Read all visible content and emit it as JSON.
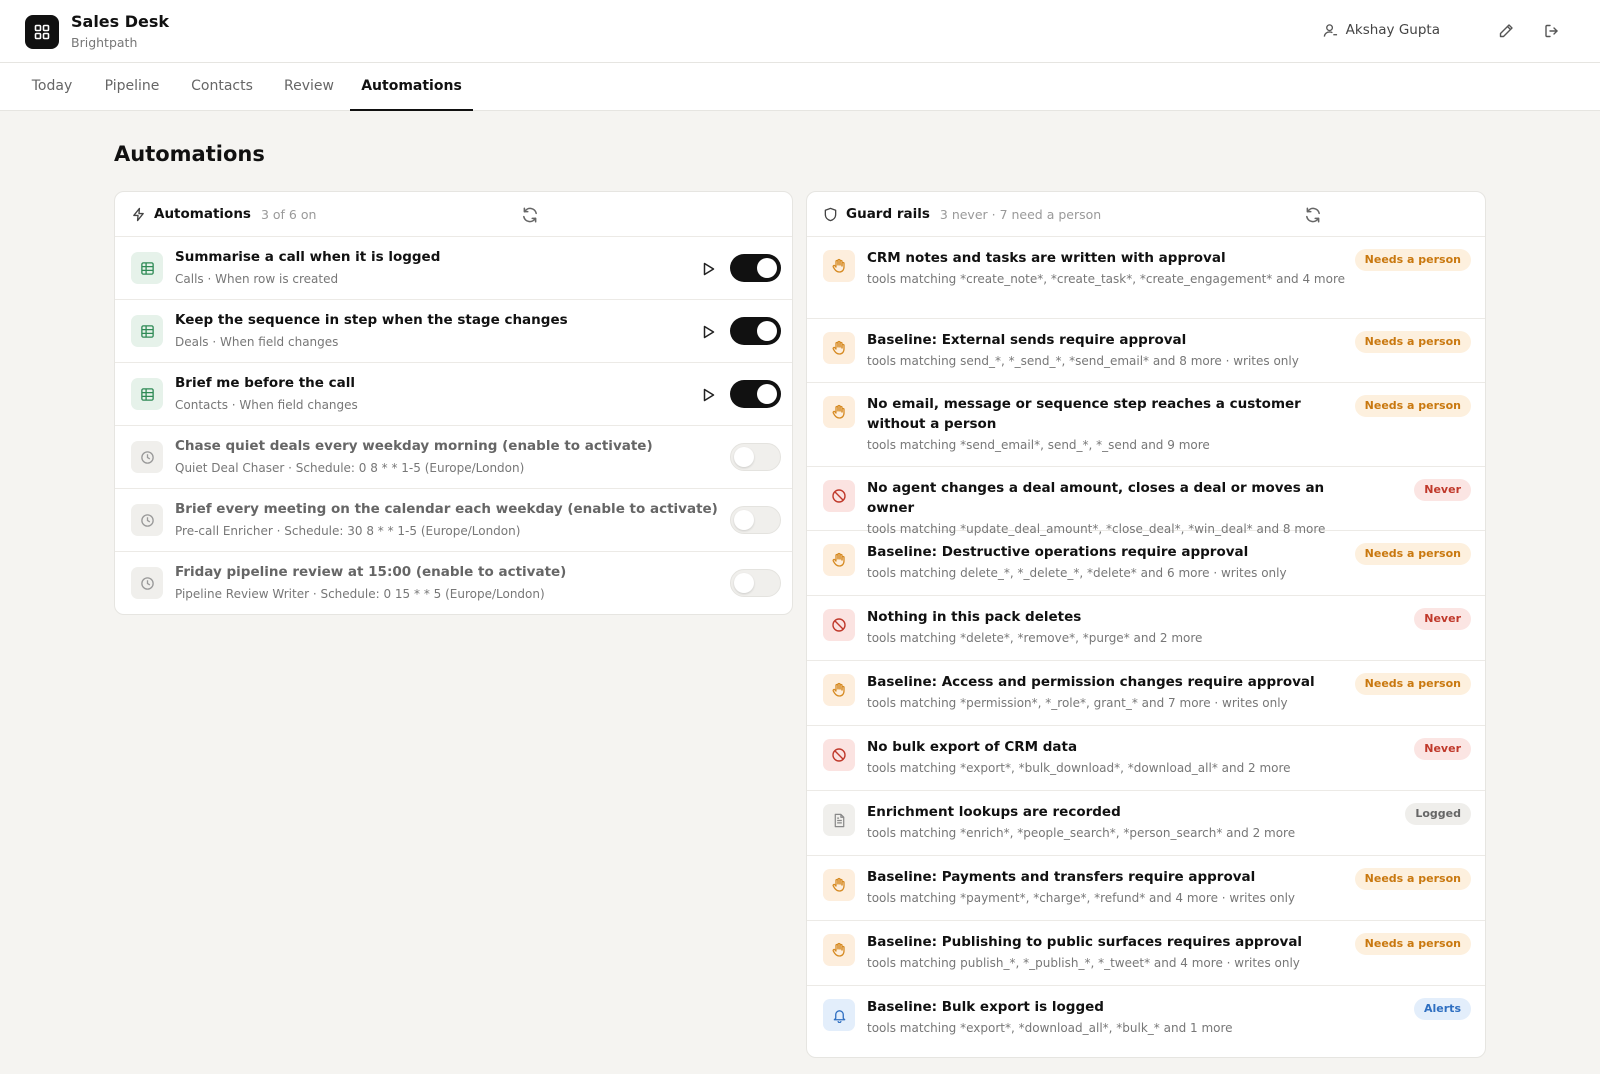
{
  "app": {
    "title": "Sales Desk",
    "subtitle": "Brightpath",
    "user": "Akshay Gupta"
  },
  "tabs": [
    "Today",
    "Pipeline",
    "Contacts",
    "Review",
    "Automations"
  ],
  "active_tab": "Automations",
  "page_title": "Automations",
  "automations": {
    "title": "Automations",
    "meta": "3 of 6 on",
    "items": [
      {
        "title": "Summarise a call when it is logged",
        "sub": "Calls · When row is created",
        "icon": "table-icon",
        "enabled": true
      },
      {
        "title": "Keep the sequence in step when the stage changes",
        "sub": "Deals · When field changes",
        "icon": "table-icon",
        "enabled": true
      },
      {
        "title": "Brief me before the call",
        "sub": "Contacts · When field changes",
        "icon": "table-icon",
        "enabled": true
      },
      {
        "title": "Chase quiet deals every weekday morning (enable to activate)",
        "sub": "Quiet Deal Chaser · Schedule: 0 8 * * 1-5 (Europe/London)",
        "icon": "clock-icon",
        "enabled": false
      },
      {
        "title": "Brief every meeting on the calendar each weekday (enable to activate)",
        "sub": "Pre-call Enricher · Schedule: 30 8 * * 1-5 (Europe/London)",
        "icon": "clock-icon",
        "enabled": false
      },
      {
        "title": "Friday pipeline review at 15:00 (enable to activate)",
        "sub": "Pipeline Review Writer · Schedule: 0 15 * * 5 (Europe/London)",
        "icon": "clock-icon",
        "enabled": false
      }
    ]
  },
  "guardrails": {
    "title": "Guard rails",
    "meta": "3 never · 7 need a person",
    "items": [
      {
        "title": "CRM notes and tasks are written with approval",
        "sub": "tools matching *create_note*, *create_task*, *create_engagement* and 4 more",
        "badge": "Needs a person",
        "kind": "person",
        "icon": "hand-icon"
      },
      {
        "title": "Baseline: External sends require approval",
        "sub": "tools matching send_*, *_send_*, *send_email* and 8 more · writes only",
        "badge": "Needs a person",
        "kind": "person",
        "icon": "hand-icon"
      },
      {
        "title": "No email, message or sequence step reaches a customer without a person",
        "sub": "tools matching *send_email*, send_*, *_send and 9 more",
        "badge": "Needs a person",
        "kind": "person",
        "icon": "hand-icon"
      },
      {
        "title": "No agent changes a deal amount, closes a deal or moves an owner",
        "sub": "tools matching *update_deal_amount*, *close_deal*, *win_deal* and 8 more",
        "badge": "Never",
        "kind": "never",
        "icon": "ban-icon"
      },
      {
        "title": "Baseline: Destructive operations require approval",
        "sub": "tools matching delete_*, *_delete_*, *delete* and 6 more · writes only",
        "badge": "Needs a person",
        "kind": "person",
        "icon": "hand-icon"
      },
      {
        "title": "Nothing in this pack deletes",
        "sub": "tools matching *delete*, *remove*, *purge* and 2 more",
        "badge": "Never",
        "kind": "never",
        "icon": "ban-icon"
      },
      {
        "title": "Baseline: Access and permission changes require approval",
        "sub": "tools matching *permission*, *_role*, grant_* and 7 more · writes only",
        "badge": "Needs a person",
        "kind": "person",
        "icon": "hand-icon"
      },
      {
        "title": "No bulk export of CRM data",
        "sub": "tools matching *export*, *bulk_download*, *download_all* and 2 more",
        "badge": "Never",
        "kind": "never",
        "icon": "ban-icon"
      },
      {
        "title": "Enrichment lookups are recorded",
        "sub": "tools matching *enrich*, *people_search*, *person_search* and 2 more",
        "badge": "Logged",
        "kind": "logged",
        "icon": "document-icon"
      },
      {
        "title": "Baseline: Payments and transfers require approval",
        "sub": "tools matching *payment*, *charge*, *refund* and 4 more · writes only",
        "badge": "Needs a person",
        "kind": "person",
        "icon": "hand-icon"
      },
      {
        "title": "Baseline: Publishing to public surfaces requires approval",
        "sub": "tools matching publish_*, *_publish_*, *_tweet* and 4 more · writes only",
        "badge": "Needs a person",
        "kind": "person",
        "icon": "hand-icon"
      },
      {
        "title": "Baseline: Bulk export is logged",
        "sub": "tools matching *export*, *download_all*, *bulk_* and 1 more",
        "badge": "Alerts",
        "kind": "alerts",
        "icon": "bell-icon"
      }
    ]
  }
}
